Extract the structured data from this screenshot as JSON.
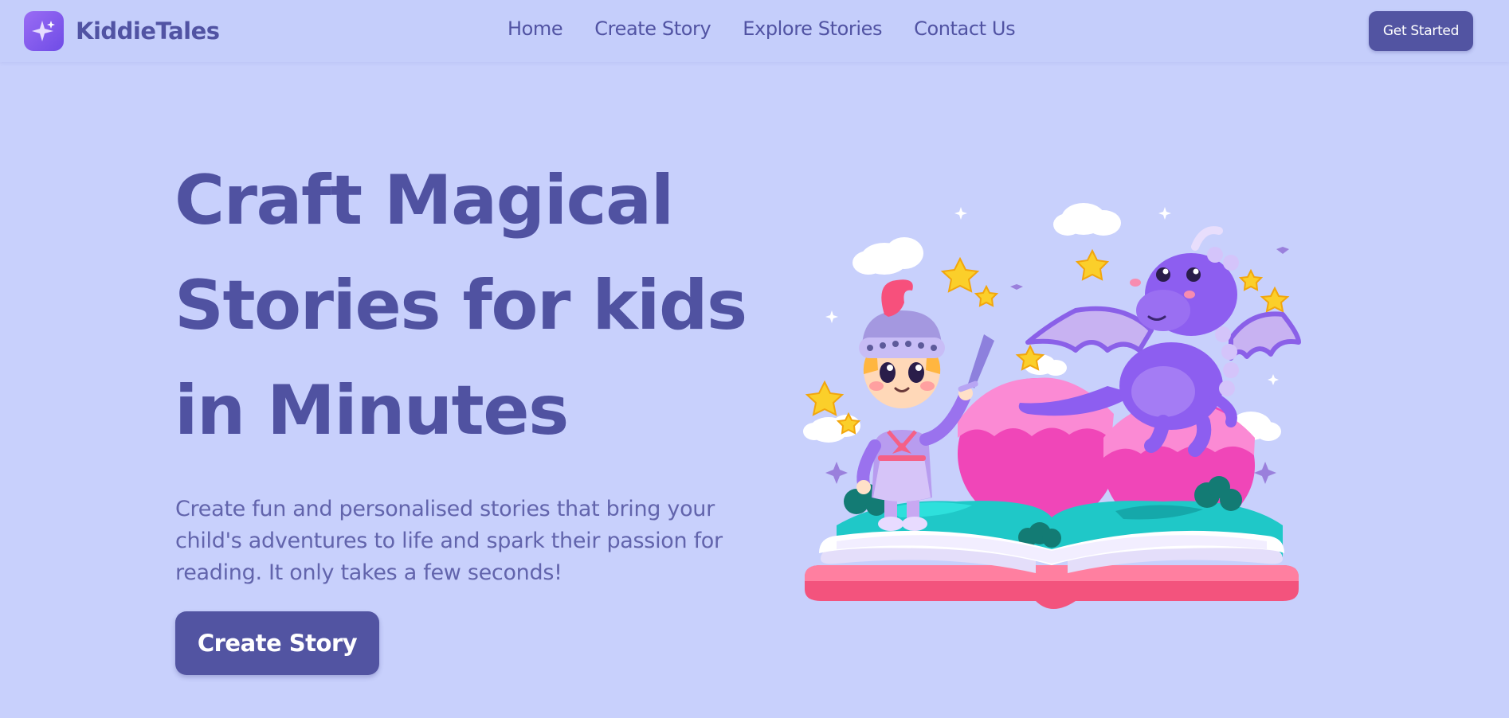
{
  "app": {
    "name": "KiddieTales",
    "logo_icon": "sparkle-icon"
  },
  "nav": {
    "items": [
      {
        "label": "Home"
      },
      {
        "label": "Create Story"
      },
      {
        "label": "Explore Stories"
      },
      {
        "label": "Contact Us"
      }
    ]
  },
  "header": {
    "cta_label": "Get Started"
  },
  "hero": {
    "title_lines": [
      "Craft Magical",
      "Stories for kids",
      "in Minutes"
    ],
    "description_lines": [
      "Create fun and personalised stories that bring your",
      "child's adventures to life and spark their passion for",
      "reading. It only takes a few seconds!"
    ],
    "cta_label": "Create Story",
    "illustration": "knight-and-dragon-storybook-illustration"
  },
  "colors": {
    "background": "#c8d0fc",
    "primary": "#5254a2",
    "text": "#5052a1",
    "logo_gradient_start": "#9a6cf4",
    "logo_gradient_end": "#6f4ce6"
  }
}
